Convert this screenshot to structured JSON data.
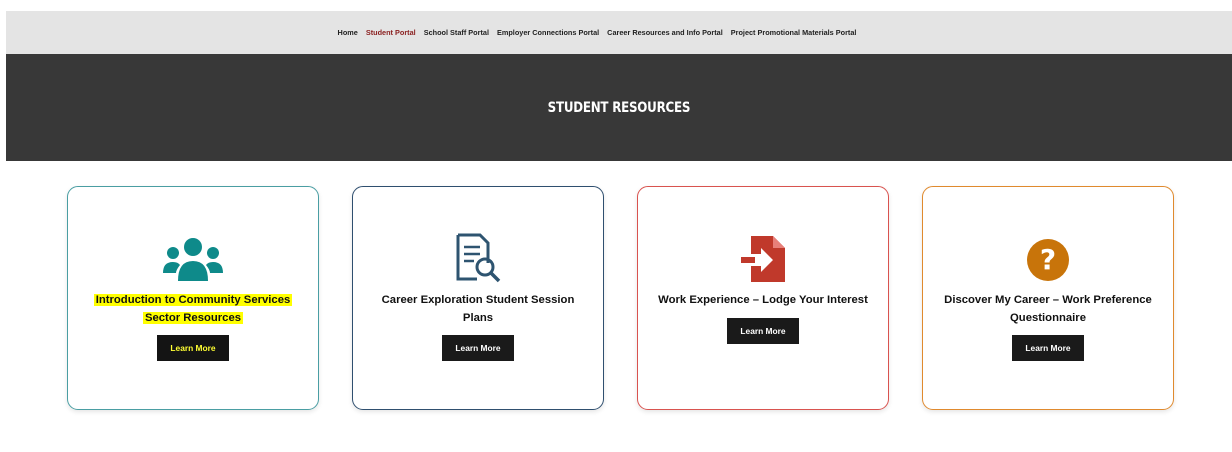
{
  "nav": {
    "items": [
      {
        "label": "Home"
      },
      {
        "label": "Student Portal"
      },
      {
        "label": "School Staff Portal"
      },
      {
        "label": "Employer Connections Portal"
      },
      {
        "label": "Career Resources and Info Portal"
      },
      {
        "label": "Project Promotional Materials Portal"
      }
    ],
    "active_index": 1
  },
  "hero": {
    "title": "STUDENT RESOURCES"
  },
  "cards": [
    {
      "title_line1": "Introduction to Community Services",
      "title_line2": "Sector Resources",
      "button": "Learn More",
      "icon": "users-group-icon",
      "border_color": "#4a9ea3",
      "icon_color": "#0e8a8a",
      "highlighted": true
    },
    {
      "title_line1": "Career Exploration Student Session",
      "title_line2": "Plans",
      "button": "Learn More",
      "icon": "document-search-icon",
      "border_color": "#2f4f6f",
      "icon_color": "#2e5470"
    },
    {
      "title_line1": "Work Experience – Lodge Your Interest",
      "button": "Learn More",
      "icon": "file-import-icon",
      "border_color": "#d9534f",
      "icon_color": "#c0392b"
    },
    {
      "title_line1": "Discover My Career – Work Preference",
      "title_line2": "Questionnaire",
      "button": "Learn More",
      "icon": "question-circle-icon",
      "border_color": "#e08a2e",
      "icon_color": "#c8740a"
    }
  ],
  "colors": {
    "nav_bg": "#e4e4e4",
    "hero_bg": "#383838",
    "active_link": "#8a1f1f",
    "button_bg": "#1a1a1a",
    "highlight": "#ffff00"
  }
}
